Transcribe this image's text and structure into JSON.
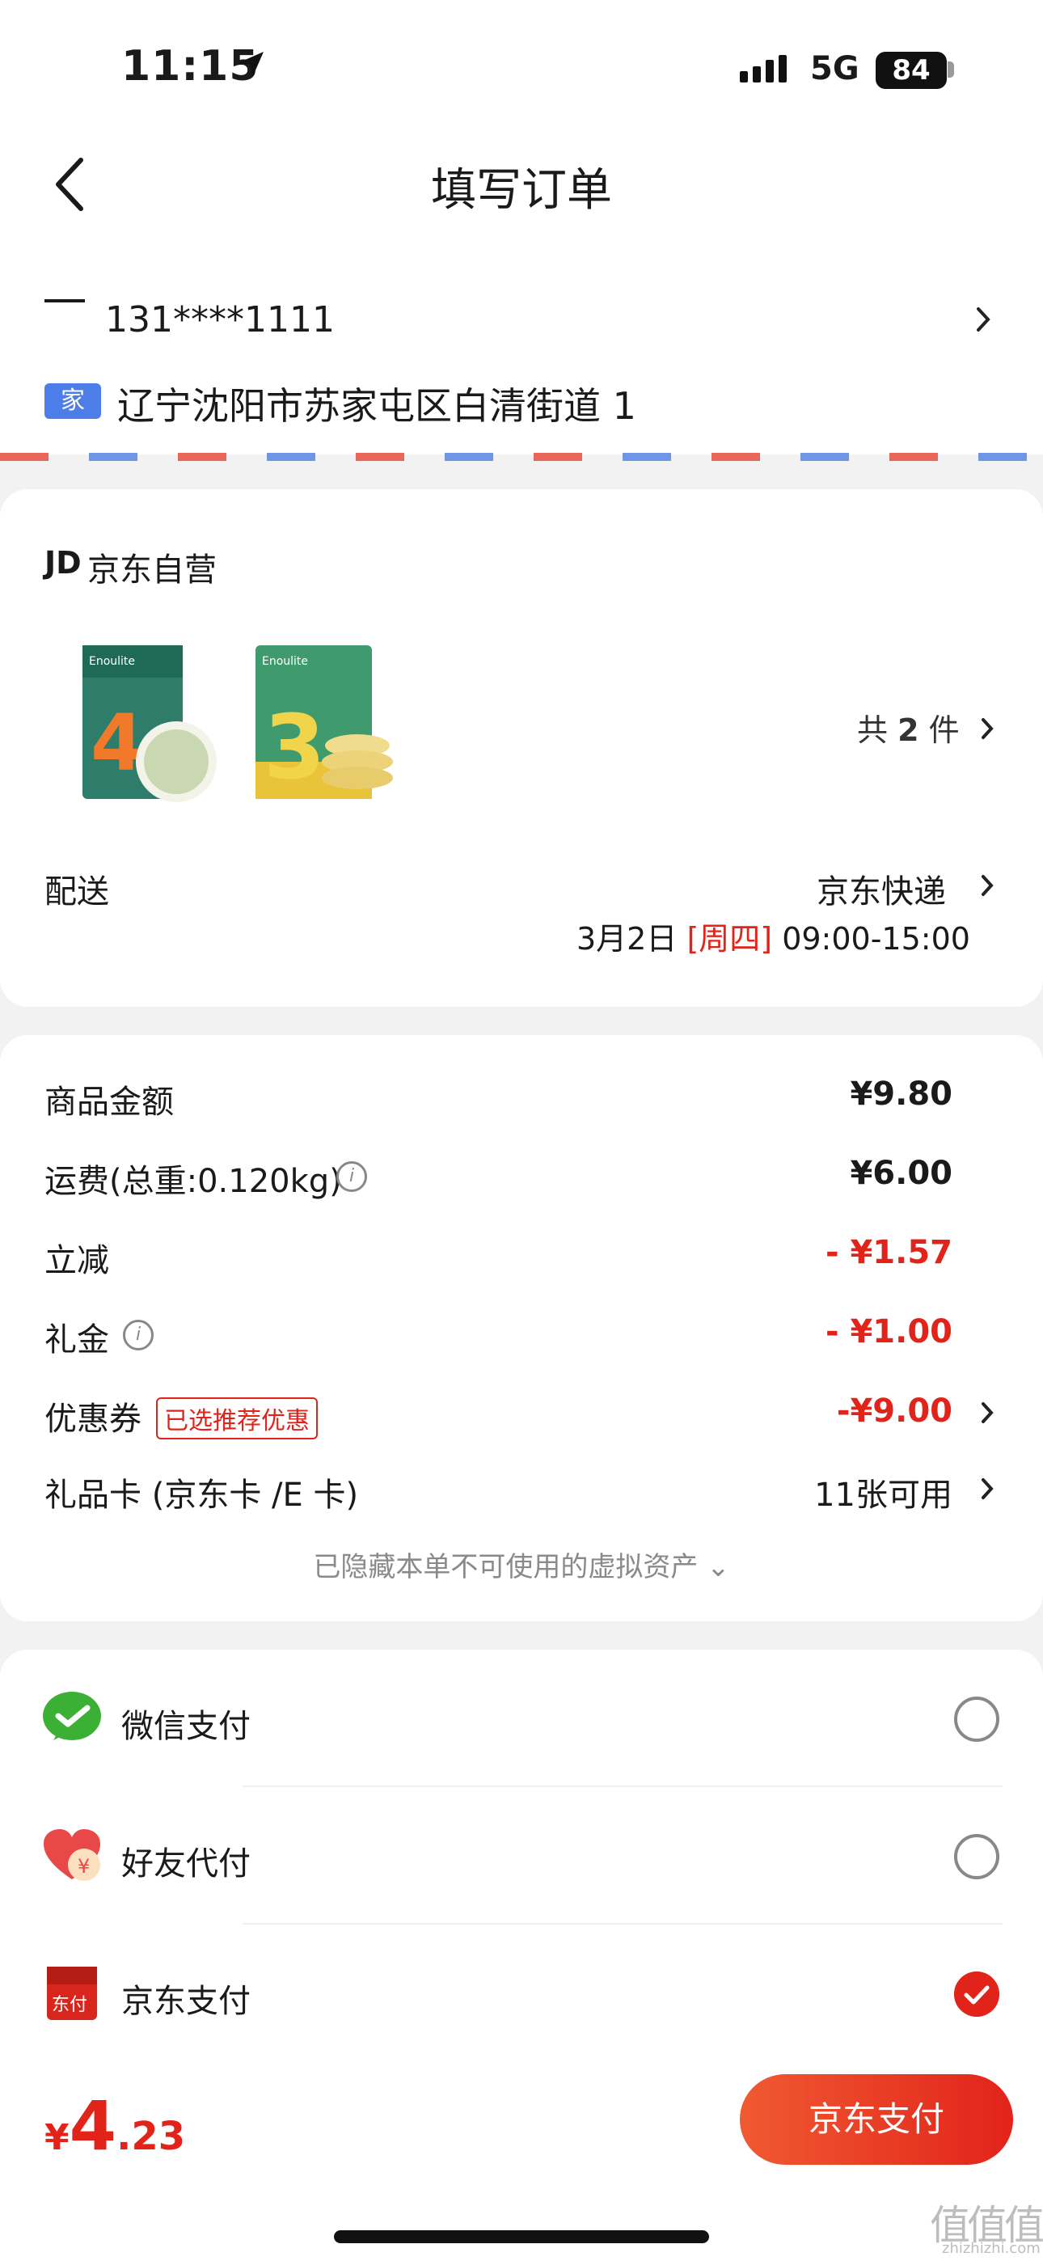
{
  "status_bar": {
    "time": "11:15",
    "network": "5G",
    "battery": "84"
  },
  "nav": {
    "title": "填写订单"
  },
  "address": {
    "phone": "131****1111",
    "tag": "家",
    "text": "辽宁沈阳市苏家屯区白清街道 1"
  },
  "shop": {
    "logo": "JD",
    "name": "京东自营",
    "items_count_prefix": "共",
    "items_count": "2",
    "items_count_suffix": "件",
    "products": [
      {
        "brand": "英氏 Enoulite",
        "number": "4",
        "color": "#2e7d6a"
      },
      {
        "brand": "英氏 Enoulite",
        "number": "3",
        "color": "#3f9b6e"
      }
    ],
    "shipping_label": "配送",
    "shipping_method": "京东快递",
    "shipping_date": "3月2日",
    "shipping_weekday": "[周四]",
    "shipping_window": "09:00-15:00"
  },
  "pricing": {
    "goods_label": "商品金额",
    "goods_value": "¥9.80",
    "freight_label": "运费(总重:0.120kg)",
    "freight_value": "¥6.00",
    "discount_label": "立减",
    "discount_value": "- ¥1.57",
    "gift_label": "礼金",
    "gift_value": "- ¥1.00",
    "coupon_label": "优惠券",
    "coupon_tag": "已选推荐优惠",
    "coupon_value": "-¥9.00",
    "giftcard_label": "礼品卡 (京东卡 /E 卡)",
    "giftcard_value": "11张可用",
    "hidden_assets": "已隐藏本单不可使用的虚拟资产 ⌄"
  },
  "payment": {
    "options": [
      {
        "label": "微信支付",
        "selected": false
      },
      {
        "label": "好友代付",
        "selected": false
      },
      {
        "label": "京东支付",
        "selected": true
      }
    ],
    "jd_icon_text": "东付",
    "friend_icon_text": "¥"
  },
  "footer": {
    "currency": "¥",
    "total_int": "4",
    "total_dec": ".23",
    "pay_button": "京东支付"
  },
  "watermark": {
    "text": "值值值",
    "url": "zhizhizhi.com"
  },
  "colors": {
    "accent": "#e2231a",
    "wechat": "#3cb034",
    "home_tag": "#4d7de8"
  }
}
